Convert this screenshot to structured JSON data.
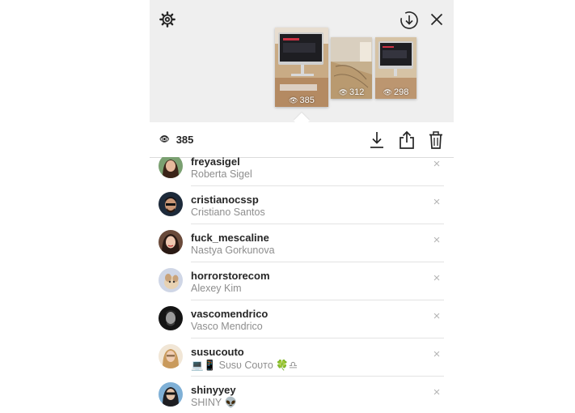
{
  "header": {
    "settings_icon": "gear-icon",
    "download_icon": "download-circle-icon",
    "close_icon": "close-icon"
  },
  "thumbnails": [
    {
      "views": "385"
    },
    {
      "views": "312"
    },
    {
      "views": "298"
    }
  ],
  "toolbar": {
    "view_count": "385",
    "icons": [
      "download-icon",
      "share-icon",
      "trash-icon"
    ]
  },
  "viewers": [
    {
      "username": "freyasigel",
      "full_name": "Roberta Sigel"
    },
    {
      "username": "cristianocssp",
      "full_name": "Cristiano Santos"
    },
    {
      "username": "fuck_mescaline",
      "full_name": "Nastya Gorkunova"
    },
    {
      "username": "horrorstorecom",
      "full_name": "Alexey Kim"
    },
    {
      "username": "vascomendrico",
      "full_name": "Vasco Mendrico"
    },
    {
      "username": "susucouto",
      "full_name": "💻📱 Sᴜsᴜ Cᴏᴜᴛᴏ 🍀♎"
    },
    {
      "username": "shinyyey",
      "full_name": "SHINY 👽"
    }
  ],
  "colors": {
    "top_background": "#efefef",
    "text_primary": "#262626",
    "text_secondary": "#8e8e8e",
    "separator": "#e3e3e3"
  }
}
